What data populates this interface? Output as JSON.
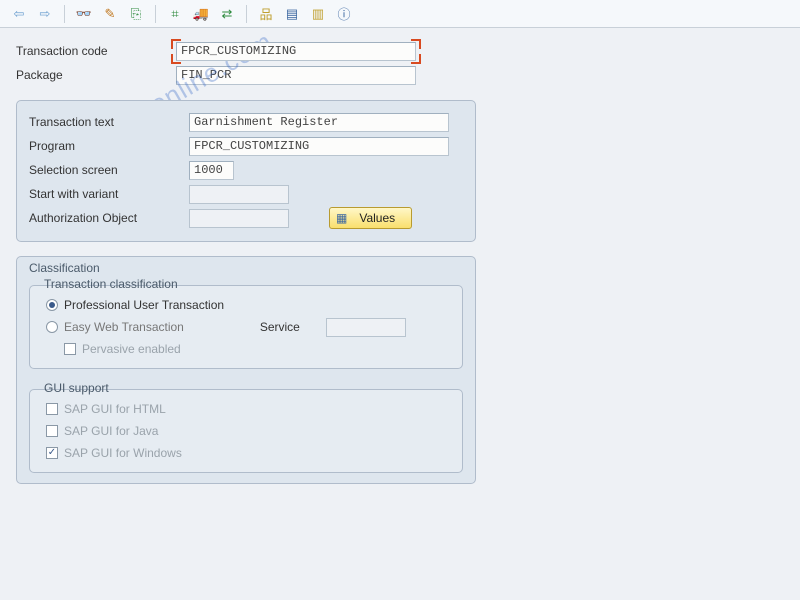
{
  "toolbar": {
    "icons": {
      "back": "⇦",
      "forward": "⇨",
      "glasses": "👓",
      "pencil": "✎",
      "copy": "⎘",
      "tree1": "⌗",
      "transport": "🚚",
      "arrowpair": "⇄",
      "hier1": "品",
      "hier2": "▤",
      "hier3": "▥",
      "info": "ⓘ"
    }
  },
  "fields": {
    "transaction_code_label": "Transaction code",
    "transaction_code_value": "FPCR_CUSTOMIZING",
    "package_label": "Package",
    "package_value": "FIN_PCR"
  },
  "details": {
    "transaction_text_label": "Transaction text",
    "transaction_text_value": "Garnishment Register",
    "program_label": "Program",
    "program_value": "FPCR_CUSTOMIZING",
    "selection_screen_label": "Selection screen",
    "selection_screen_value": "1000",
    "start_variant_label": "Start with variant",
    "start_variant_value": "",
    "auth_object_label": "Authorization Object",
    "auth_object_value": "",
    "values_btn": "Values",
    "values_btn_icon": "▦"
  },
  "classification": {
    "title": "Classification",
    "trans_class_title": "Transaction classification",
    "opt_pro": "Professional User Transaction",
    "opt_easy": "Easy Web Transaction",
    "pervasive": "Pervasive enabled",
    "service_label": "Service",
    "service_value": "",
    "gui_support_title": "GUI support",
    "gui_html": "SAP GUI for HTML",
    "gui_java": "SAP GUI for Java",
    "gui_win": "SAP GUI for Windows"
  },
  "watermark": "sapbrainsonline.com"
}
